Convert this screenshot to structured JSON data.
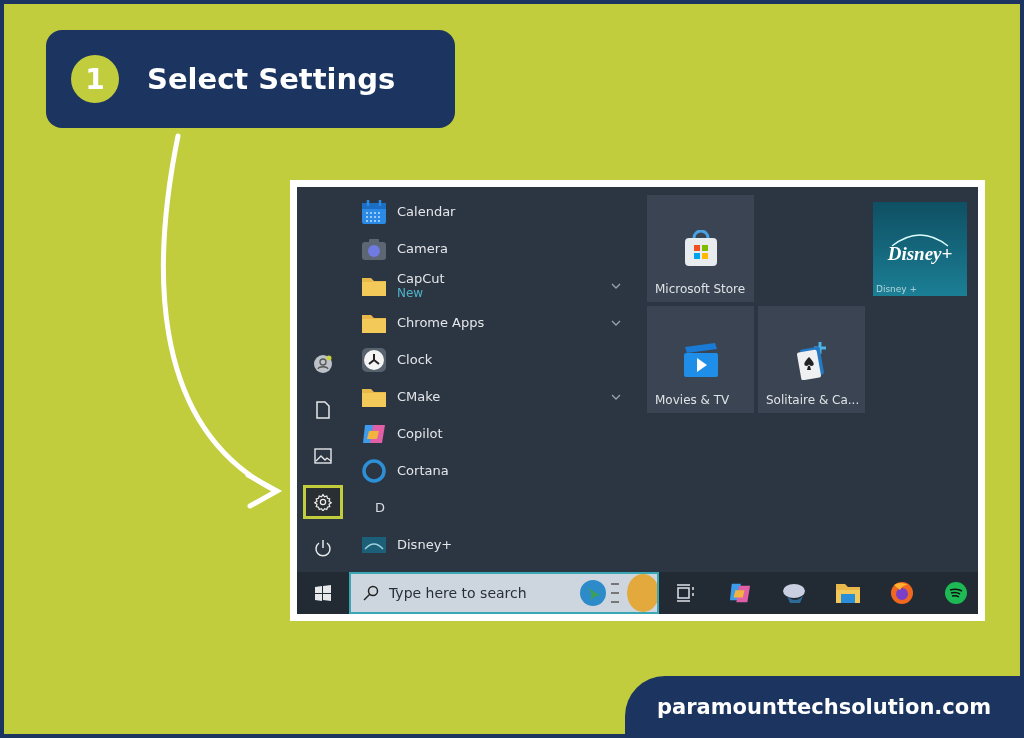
{
  "step": {
    "number": "1",
    "title": "Select Settings"
  },
  "start_menu": {
    "rail": [
      {
        "kind": "user",
        "selected": false
      },
      {
        "kind": "documents",
        "selected": false
      },
      {
        "kind": "pictures",
        "selected": false
      },
      {
        "kind": "settings",
        "selected": true
      },
      {
        "kind": "power",
        "selected": false
      }
    ],
    "apps": [
      {
        "kind": "calendar",
        "label": "Calendar",
        "expandable": false
      },
      {
        "kind": "camera",
        "label": "Camera",
        "expandable": false
      },
      {
        "kind": "folder",
        "label": "CapCut",
        "subtitle": "New",
        "expandable": true
      },
      {
        "kind": "folder",
        "label": "Chrome Apps",
        "expandable": true
      },
      {
        "kind": "clock",
        "label": "Clock",
        "expandable": false
      },
      {
        "kind": "folder",
        "label": "CMake",
        "expandable": true
      },
      {
        "kind": "copilot",
        "label": "Copilot",
        "expandable": false
      },
      {
        "kind": "cortana",
        "label": "Cortana",
        "expandable": false
      },
      {
        "kind": "header",
        "label": "D"
      },
      {
        "kind": "disney",
        "label": "Disney+",
        "expandable": false
      }
    ],
    "tiles": [
      {
        "kind": "store",
        "label": "Microsoft Store"
      },
      {
        "kind": "empty"
      },
      {
        "kind": "disney",
        "logo": "Disney+",
        "label": "Disney +"
      },
      {
        "kind": "movies",
        "label": "Movies & TV"
      },
      {
        "kind": "solitaire",
        "label": "Solitaire & Ca..."
      },
      {
        "kind": "empty"
      }
    ]
  },
  "taskbar": {
    "search": {
      "placeholder": "Type here to search"
    },
    "icons": [
      {
        "kind": "taskview"
      },
      {
        "kind": "copilot"
      },
      {
        "kind": "ball"
      },
      {
        "kind": "folder"
      },
      {
        "kind": "firefox"
      },
      {
        "kind": "spotify"
      }
    ]
  },
  "footer": {
    "site": "paramounttechsolution.com"
  }
}
